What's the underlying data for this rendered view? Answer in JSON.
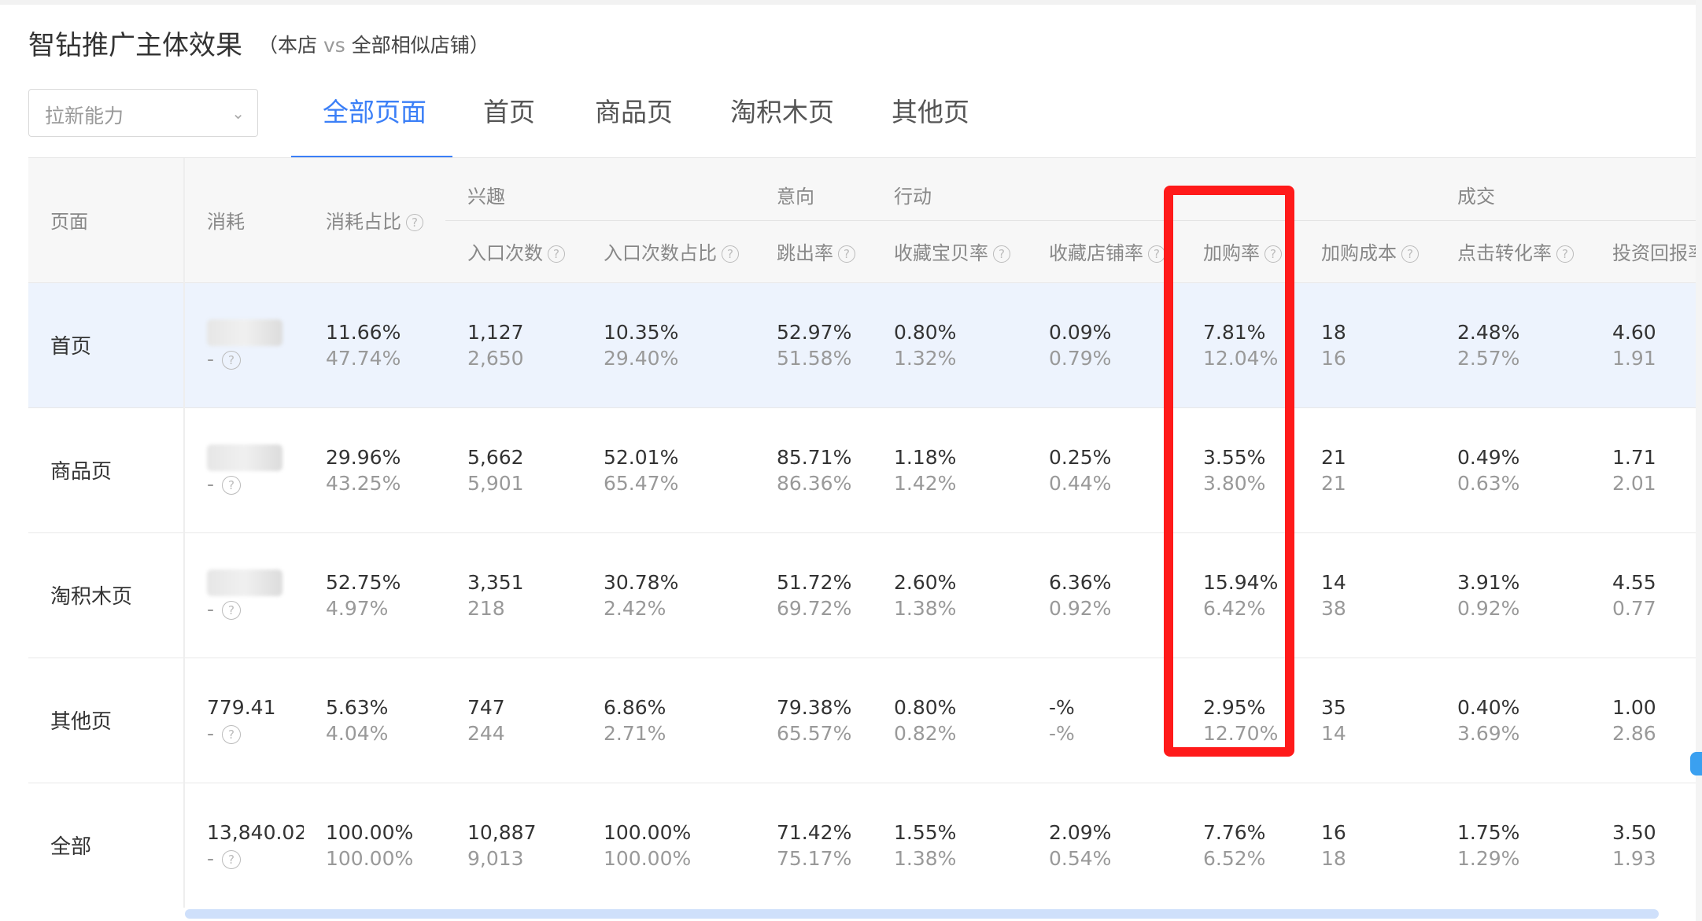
{
  "header": {
    "title": "智钻推广主体效果",
    "subtitle_open": "（本店",
    "subtitle_vs": "vs",
    "subtitle_rest": "全部相似店铺）"
  },
  "filter": {
    "value": "拉新能力"
  },
  "tabs": [
    {
      "label": "全部页面",
      "active": true
    },
    {
      "label": "首页"
    },
    {
      "label": "商品页"
    },
    {
      "label": "淘积木页"
    },
    {
      "label": "其他页"
    }
  ],
  "table": {
    "groups": {
      "interest": "兴趣",
      "intent": "意向",
      "action": "行动",
      "deal": "成交"
    },
    "headers": {
      "page": "页面",
      "cost": "消耗",
      "cost_share": "消耗占比",
      "entries": "入口次数",
      "entry_share": "入口次数占比",
      "bounce": "跳出率",
      "fav_item": "收藏宝贝率",
      "fav_shop": "收藏店铺率",
      "cart_rate": "加购率",
      "cart_cost": "加购成本",
      "ctr_conv": "点击转化率",
      "roi": "投资回报率"
    },
    "rows": [
      {
        "page": "首页",
        "cost2": "-",
        "cost_share": [
          "11.66%",
          "47.74%"
        ],
        "entries": [
          "1,127",
          "2,650"
        ],
        "entry_share": [
          "10.35%",
          "29.40%"
        ],
        "bounce": [
          "52.97%",
          "51.58%"
        ],
        "fav_item": [
          "0.80%",
          "1.32%"
        ],
        "fav_shop": [
          "0.09%",
          "0.79%"
        ],
        "cart_rate": [
          "7.81%",
          "12.04%"
        ],
        "cart_cost": [
          "18",
          "16"
        ],
        "ctr_conv": [
          "2.48%",
          "2.57%"
        ],
        "roi": [
          "4.60",
          "1.91"
        ]
      },
      {
        "page": "商品页",
        "cost2": "-",
        "cost_share": [
          "29.96%",
          "43.25%"
        ],
        "entries": [
          "5,662",
          "5,901"
        ],
        "entry_share": [
          "52.01%",
          "65.47%"
        ],
        "bounce": [
          "85.71%",
          "86.36%"
        ],
        "fav_item": [
          "1.18%",
          "1.42%"
        ],
        "fav_shop": [
          "0.25%",
          "0.44%"
        ],
        "cart_rate": [
          "3.55%",
          "3.80%"
        ],
        "cart_cost": [
          "21",
          "21"
        ],
        "ctr_conv": [
          "0.49%",
          "0.63%"
        ],
        "roi": [
          "1.71",
          "2.01"
        ]
      },
      {
        "page": "淘积木页",
        "cost2": "-",
        "cost_share": [
          "52.75%",
          "4.97%"
        ],
        "entries": [
          "3,351",
          "218"
        ],
        "entry_share": [
          "30.78%",
          "2.42%"
        ],
        "bounce": [
          "51.72%",
          "69.72%"
        ],
        "fav_item": [
          "2.60%",
          "1.38%"
        ],
        "fav_shop": [
          "6.36%",
          "0.92%"
        ],
        "cart_rate": [
          "15.94%",
          "6.42%"
        ],
        "cart_cost": [
          "14",
          "38"
        ],
        "ctr_conv": [
          "3.91%",
          "0.92%"
        ],
        "roi": [
          "4.55",
          "0.77"
        ]
      },
      {
        "page": "其他页",
        "cost1": "779.41",
        "cost2": "-",
        "cost_share": [
          "5.63%",
          "4.04%"
        ],
        "entries": [
          "747",
          "244"
        ],
        "entry_share": [
          "6.86%",
          "2.71%"
        ],
        "bounce": [
          "79.38%",
          "65.57%"
        ],
        "fav_item": [
          "0.80%",
          "0.82%"
        ],
        "fav_shop": [
          "-%",
          "-%"
        ],
        "cart_rate": [
          "2.95%",
          "12.70%"
        ],
        "cart_cost": [
          "35",
          "14"
        ],
        "ctr_conv": [
          "0.40%",
          "3.69%"
        ],
        "roi": [
          "1.00",
          "2.86"
        ]
      },
      {
        "page": "全部",
        "cost1": "13,840.02",
        "cost2": "-",
        "cost_share": [
          "100.00%",
          "100.00%"
        ],
        "entries": [
          "10,887",
          "9,013"
        ],
        "entry_share": [
          "100.00%",
          "100.00%"
        ],
        "bounce": [
          "71.42%",
          "75.17%"
        ],
        "fav_item": [
          "1.55%",
          "1.38%"
        ],
        "fav_shop": [
          "2.09%",
          "0.54%"
        ],
        "cart_rate": [
          "7.76%",
          "6.52%"
        ],
        "cart_cost": [
          "16",
          "18"
        ],
        "ctr_conv": [
          "1.75%",
          "1.29%"
        ],
        "roi": [
          "3.50",
          "1.93"
        ]
      }
    ]
  },
  "colors": {
    "accent": "#3b7ff7",
    "highlight_row": "#edf3fd",
    "annotation": "#ff1a1a"
  }
}
